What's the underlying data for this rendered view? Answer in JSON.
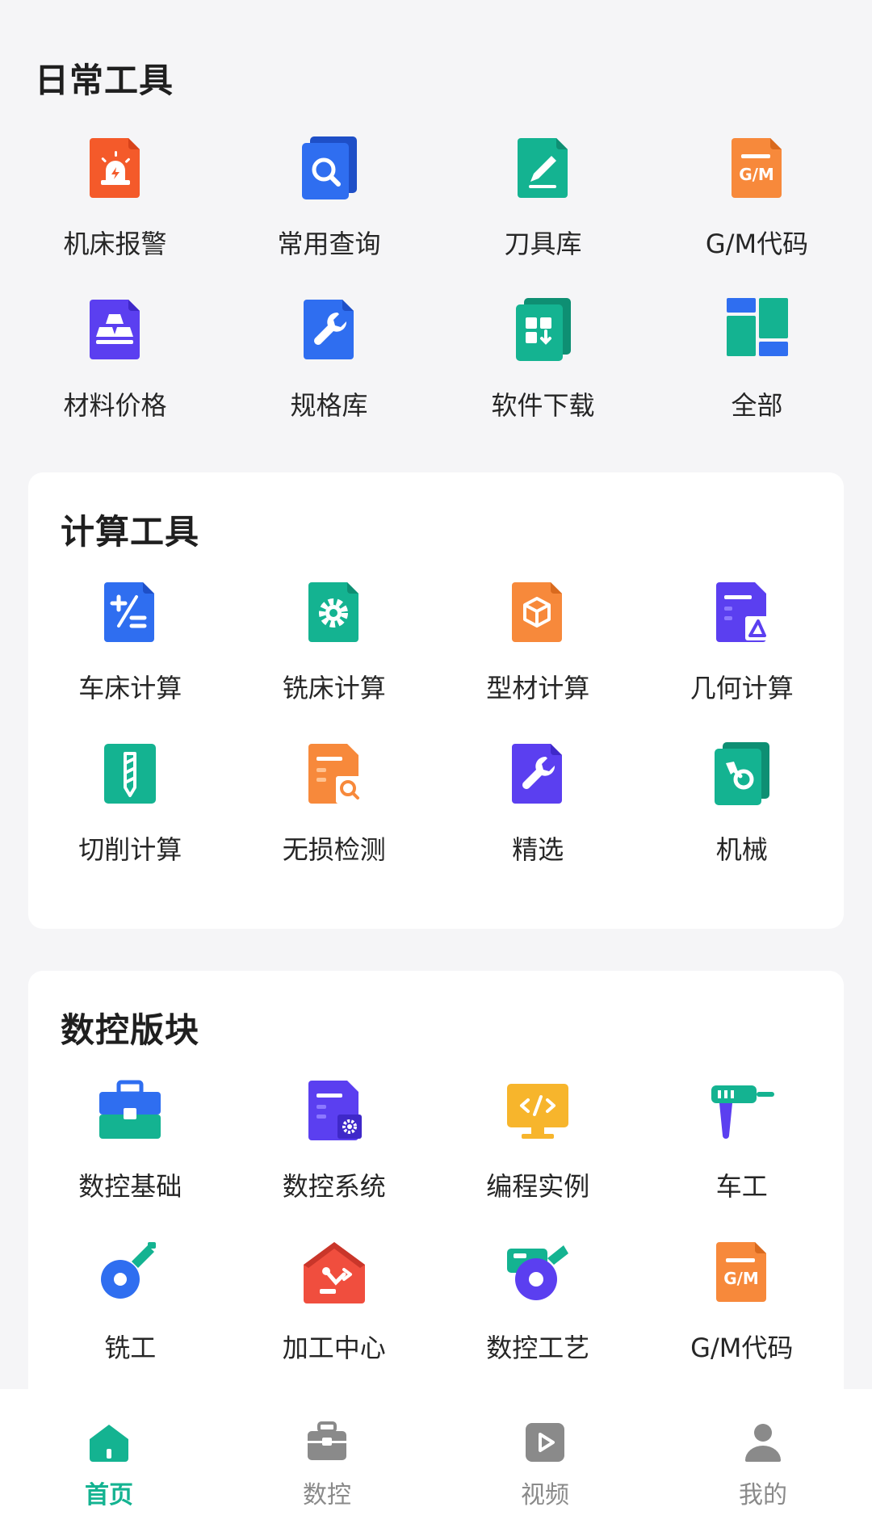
{
  "colors": {
    "accent": "#14b391",
    "background": "#f5f5f7",
    "card": "#ffffff",
    "inactive": "#8a8a8a"
  },
  "daily": {
    "title": "日常工具",
    "items": [
      {
        "label": "机床报警",
        "icon": "alarm-light-icon"
      },
      {
        "label": "常用查询",
        "icon": "search-doc-icon"
      },
      {
        "label": "刀具库",
        "icon": "pen-doc-icon"
      },
      {
        "label": "G/M代码",
        "icon": "gm-code-icon"
      },
      {
        "label": "材料价格",
        "icon": "gold-bars-icon"
      },
      {
        "label": "规格库",
        "icon": "wrench-doc-icon"
      },
      {
        "label": "软件下载",
        "icon": "app-download-icon"
      },
      {
        "label": "全部",
        "icon": "grid-all-icon"
      }
    ]
  },
  "calc": {
    "title": "计算工具",
    "items": [
      {
        "label": "车床计算",
        "icon": "plus-minus-doc-icon"
      },
      {
        "label": "铣床计算",
        "icon": "gear-doc-icon"
      },
      {
        "label": "型材计算",
        "icon": "cube-doc-icon"
      },
      {
        "label": "几何计算",
        "icon": "triangle-doc-icon"
      },
      {
        "label": "切削计算",
        "icon": "drill-bit-doc-icon"
      },
      {
        "label": "无损检测",
        "icon": "inspect-doc-icon"
      },
      {
        "label": "精选",
        "icon": "wrench-doc-icon"
      },
      {
        "label": "机械",
        "icon": "mechanical-icon"
      }
    ]
  },
  "cnc": {
    "title": "数控版块",
    "items": [
      {
        "label": "数控基础",
        "icon": "toolbox-icon"
      },
      {
        "label": "数控系统",
        "icon": "settings-doc-icon"
      },
      {
        "label": "编程实例",
        "icon": "code-monitor-icon"
      },
      {
        "label": "车工",
        "icon": "drill-gun-icon"
      },
      {
        "label": "铣工",
        "icon": "angle-grinder-icon"
      },
      {
        "label": "加工中心",
        "icon": "robot-factory-icon"
      },
      {
        "label": "数控工艺",
        "icon": "saw-machine-icon"
      },
      {
        "label": "G/M代码",
        "icon": "gm-code-icon"
      }
    ]
  },
  "tabbar": {
    "items": [
      {
        "label": "首页",
        "icon": "home-icon",
        "active": true
      },
      {
        "label": "数控",
        "icon": "toolbox-icon",
        "active": false
      },
      {
        "label": "视频",
        "icon": "video-play-icon",
        "active": false
      },
      {
        "label": "我的",
        "icon": "user-icon",
        "active": false
      }
    ]
  }
}
